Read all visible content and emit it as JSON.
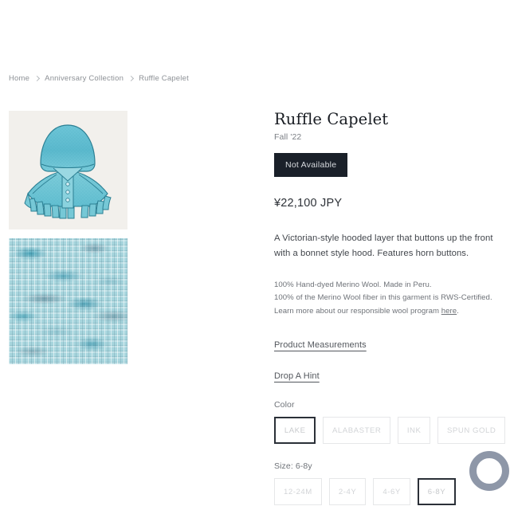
{
  "breadcrumb": {
    "items": [
      {
        "label": "Home"
      },
      {
        "label": "Anniversary Collection"
      },
      {
        "label": "Ruffle Capelet"
      }
    ]
  },
  "media": {
    "illustration_alt": "Teal hooded ruffle capelet illustration",
    "swatch_alt": "Variegated blue knitted wool swatch"
  },
  "product": {
    "title": "Ruffle Capelet",
    "season": "Fall '22",
    "availability_label": "Not Available",
    "price": "¥22,100 JPY",
    "description": "A Victorian-style hooded layer that buttons up the front with a bonnet style hood. Features horn buttons.",
    "fineprint_line1": "100% Hand-dyed Merino Wool. Made in Peru.",
    "fineprint_line2": "100% of the Merino Wool fiber in this garment is RWS-Certified.",
    "fineprint_line3_prefix": "Learn more about our responsible wool program ",
    "fineprint_link": "here",
    "fineprint_line3_suffix": "."
  },
  "links": {
    "measurements": "Product Measurements",
    "drop_a_hint": "Drop A Hint"
  },
  "color": {
    "label": "Color",
    "selected": "LAKE",
    "options": [
      {
        "label": "LAKE",
        "selected": true
      },
      {
        "label": "ALABASTER",
        "selected": false
      },
      {
        "label": "INK",
        "selected": false
      },
      {
        "label": "SPUN GOLD",
        "selected": false
      }
    ]
  },
  "size": {
    "label": "Size: 6-8y",
    "selected": "6-8Y",
    "options": [
      {
        "label": "12-24M",
        "selected": false
      },
      {
        "label": "2-4Y",
        "selected": false
      },
      {
        "label": "4-6Y",
        "selected": false
      },
      {
        "label": "6-8Y",
        "selected": true
      }
    ]
  },
  "widgets": {
    "chat_label": "chat-bubble-icon"
  },
  "colors": {
    "button_dark": "#1a2029",
    "selected_border": "#2b3038",
    "swatch_border": "#e6e7e9",
    "chat_accent": "#8e97a8"
  }
}
